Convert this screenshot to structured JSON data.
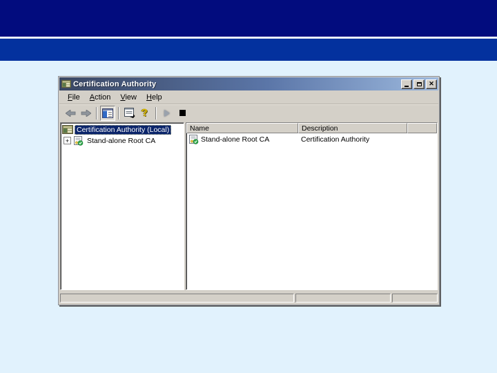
{
  "slide": {
    "background": "#e1f2fd",
    "band_top_color": "#020c7e",
    "band_divider_color": "#eef3fb",
    "band_bottom_color": "#03319e"
  },
  "window": {
    "title": "Certification Authority",
    "titlebar_gradient_left": "#3a4763",
    "titlebar_gradient_right": "#9db9de",
    "controls": {
      "minimize": "minimize",
      "maximize": "maximize",
      "close_glyph": "✕"
    },
    "menu": {
      "items": [
        "File",
        "Action",
        "View",
        "Help"
      ]
    },
    "toolbar": {
      "icons": [
        "back",
        "forward",
        "show-console-tree",
        "export-list",
        "help",
        "start-service",
        "stop-service"
      ],
      "help_glyph": "?"
    },
    "tree": {
      "root": {
        "label": "Certification Authority (Local)",
        "selected": true
      },
      "children": [
        {
          "expander": "+",
          "label": "Stand-alone Root CA"
        }
      ]
    },
    "list": {
      "columns": [
        "Name",
        "Description"
      ],
      "rows": [
        {
          "name": "Stand-alone Root CA",
          "description": "Certification Authority"
        }
      ]
    },
    "colors": {
      "chrome": "#d4d0c8",
      "selection": "#0a246a",
      "pane_bg": "#ffffff"
    }
  }
}
